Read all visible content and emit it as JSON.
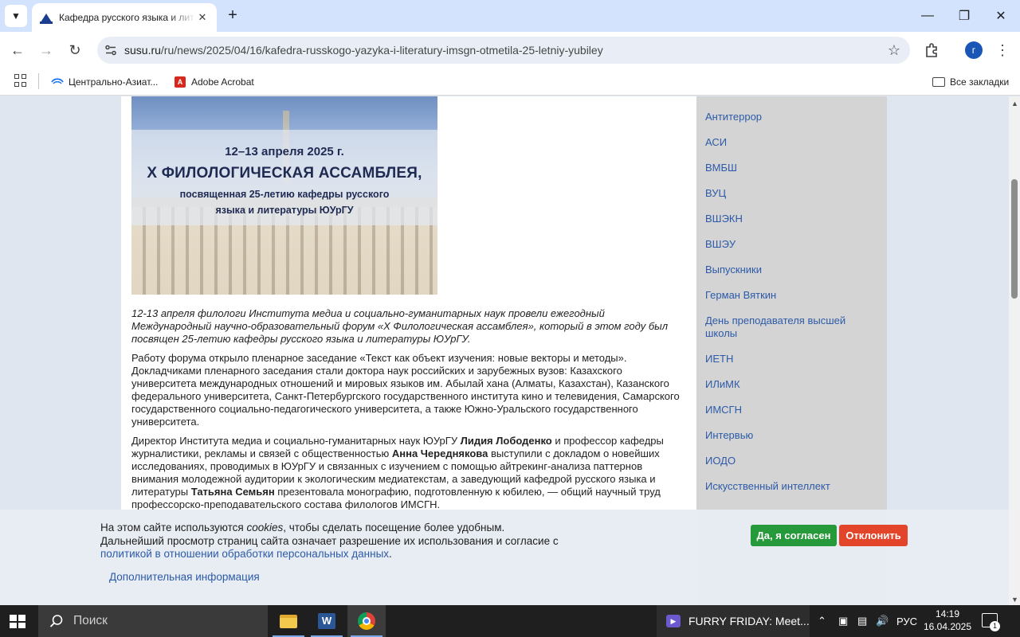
{
  "browser": {
    "tab_title": "Кафедра русского языка и лит",
    "url_host": "susu.ru",
    "url_path": "/ru/news/2025/04/16/kafedra-russkogo-yazyka-i-literatury-imsgn-otmetila-25-letniy-yubiley",
    "profile_initial": "г",
    "bookmarks": [
      {
        "label": "Центрально-Азиат...",
        "icon": "link-icon"
      },
      {
        "label": "Adobe Acrobat",
        "icon": "acrobat-icon"
      }
    ],
    "all_bookmarks": "Все закладки"
  },
  "banner": {
    "date": "12–13 апреля 2025 г.",
    "title": "X ФИЛОЛОГИЧЕСКАЯ АССАМБЛЕЯ,",
    "subtitle_line1": "посвященная 25-летию кафедры русского",
    "subtitle_line2": "языка и литературы ЮУрГУ"
  },
  "article": {
    "lead": "12-13 апреля филологи Института медиа и социально-гуманитарных наук провели ежегодный Международный научно-образовательный форум «X Филологическая ассамблея», который в этом году был посвящен 25-летию кафедры русского языка и литературы ЮУрГУ.",
    "p1": "Работу форума открыло пленарное заседание «Текст как объект изучения: новые векторы и методы». Докладчиками пленарного заседания стали доктора наук российских и зарубежных вузов: Казахского университета международных отношений и мировых языков им. Абылай хана (Алматы, Казахстан), Казанского федерального университета, Санкт-Петербургского государственного института кино и телевидения, Самарского государственного социально-педагогического университета, а также Южно-Уральского государственного университета.",
    "p2_a": "Директор Института медиа и социально-гуманитарных наук ЮУрГУ ",
    "p2_name1": "Лидия Лободенко",
    "p2_b": " и профессор кафедры журналистики, рекламы и связей с общественностью ",
    "p2_name2": "Анна Череднякова",
    "p2_c": " выступили с докладом о новейших исследованиях, проводимых в ЮУрГУ и связанных с изучением с помощью айтрекинг-анализа паттернов внимания молодежной аудитории к экологическим медиатекстам, а заведующий кафедрой русского языка и литературы ",
    "p2_name3": "Татьяна Семьян",
    "p2_d": " презентовала монографию, подготовленную к юбилею, — общий научный труд профессорско-преподавательского состава филологов ИМСГН."
  },
  "sidebar": {
    "items": [
      "Антитеррор",
      "АСИ",
      "ВМБШ",
      "ВУЦ",
      "ВШЭКН",
      "ВШЭУ",
      "Выпускники",
      "Герман Вяткин",
      "День преподавателя высшей школы",
      "ИЕТН",
      "ИЛиМК",
      "ИМСГН",
      "Интервью",
      "ИОДО",
      "Искусственный интеллект"
    ]
  },
  "cookie": {
    "text_a": "На этом сайте используются ",
    "text_cookies": "cookies",
    "text_b": ", чтобы сделать посещение более удобным. Дальнейший просмотр страниц сайта означает разрешение их использования и согласие с ",
    "policy_link": "политикой в отношении обработки персональных данных",
    "text_c": ".",
    "more_link": "Дополнительная информация",
    "accept": "Да, я согласен",
    "decline": "Отклонить"
  },
  "taskbar": {
    "search_placeholder": "Поиск",
    "media_title": "FURRY FRIDAY: Meet...",
    "language": "РУС",
    "time": "14:19",
    "date": "16.04.2025",
    "notification_count": "1"
  }
}
